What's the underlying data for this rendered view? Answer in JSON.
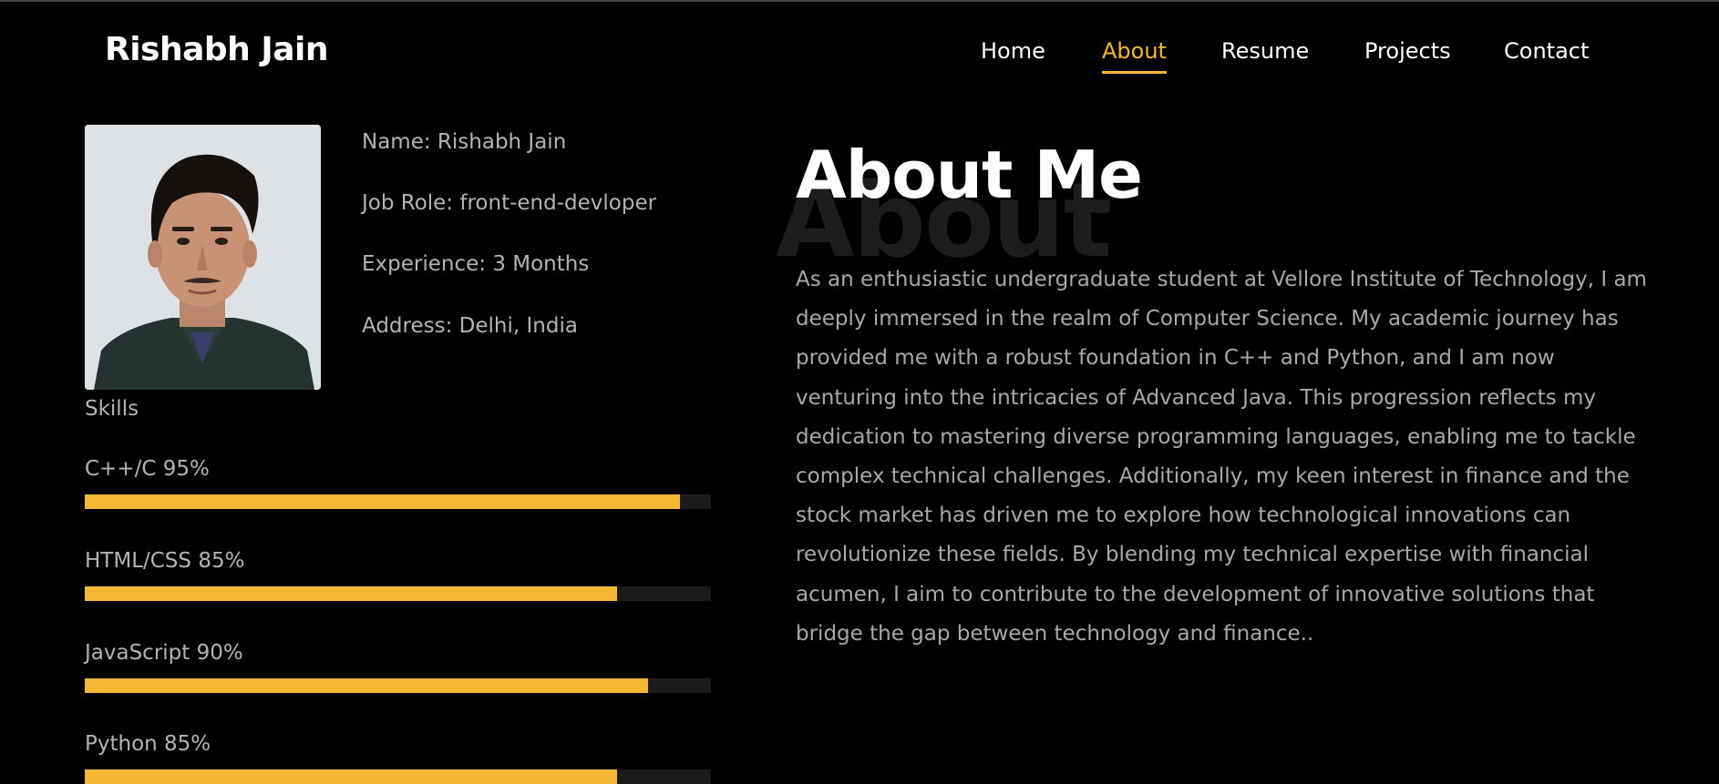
{
  "header": {
    "brand": "Rishabh Jain",
    "nav": [
      {
        "label": "Home",
        "active": false
      },
      {
        "label": "About",
        "active": true
      },
      {
        "label": "Resume",
        "active": false
      },
      {
        "label": "Projects",
        "active": false
      },
      {
        "label": "Contact",
        "active": false
      }
    ]
  },
  "profile": {
    "name": "Name: Rishabh Jain",
    "job_role": "Job Role: front-end-devloper",
    "experience": "Experience: 3 Months",
    "address": "Address: Delhi, India"
  },
  "skills": {
    "title": "Skills",
    "items": [
      {
        "label": "C++/C 95%",
        "level": 0.95
      },
      {
        "label": "HTML/CSS 85%",
        "level": 0.85
      },
      {
        "label": "JavaScript 90%",
        "level": 0.9
      },
      {
        "label": "Python 85%",
        "level": 0.85
      }
    ]
  },
  "about": {
    "background_word": "About",
    "title": "About Me",
    "text": "As an enthusiastic undergraduate student at Vellore Institute of Technology, I am deeply immersed in the realm of Computer Science. My academic journey has provided me with a robust foundation in C++ and Python, and I am now venturing into the intricacies of Advanced Java. This progression reflects my dedication to mastering diverse programming languages, enabling me to tackle complex technical challenges. Additionally, my keen interest in finance and the stock market has driven me to explore how technological innovations can revolutionize these fields. By blending my technical expertise with financial acumen, I aim to contribute to the development of innovative solutions that bridge the gap between technology and finance.."
  },
  "colors": {
    "accent": "#f5b733",
    "background": "#000000",
    "text": "#b3b3b3",
    "track": "#1b1b1b"
  }
}
